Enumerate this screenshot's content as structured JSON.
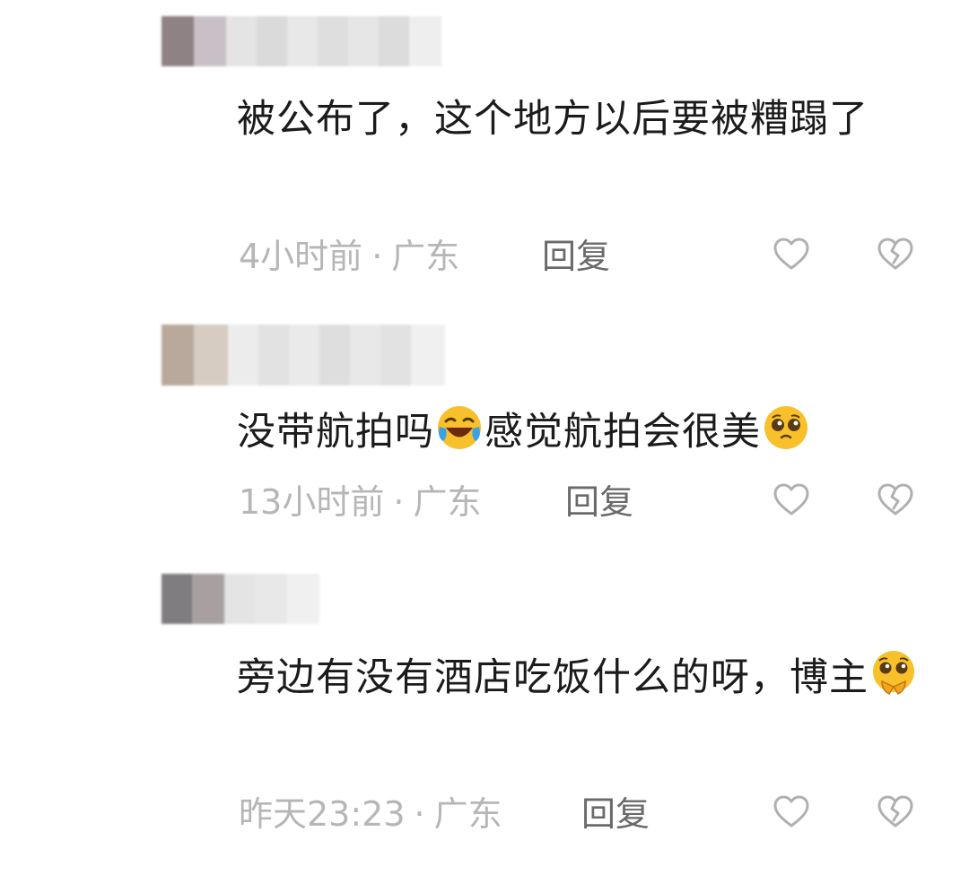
{
  "comments": [
    {
      "text": "被公布了，这个地方以后要被糟蹋了",
      "time": "4小时前",
      "location": "广东",
      "reply_label": "回复"
    },
    {
      "text_parts": [
        "没带航拍吗",
        "感觉航拍会很美"
      ],
      "time": "13小时前",
      "location": "广东",
      "reply_label": "回复",
      "emojis": [
        "laughing-crying-emoji",
        "pleading-face-emoji"
      ]
    },
    {
      "text": "旁边有没有酒店吃饭什么的呀，博主",
      "time": "昨天23:23",
      "location": "广东",
      "reply_label": "回复",
      "emojis": [
        "pleading-hands-emoji"
      ]
    }
  ],
  "separator": "·",
  "icons": {
    "like": "heart-outline-icon",
    "dislike": "broken-heart-icon"
  },
  "colors": {
    "text": "#1b1b1b",
    "meta": "#b6b6b6",
    "reply": "#6a6a6a",
    "icon": "#b0b0b0",
    "emoji_yellow": "#f8c12b"
  }
}
